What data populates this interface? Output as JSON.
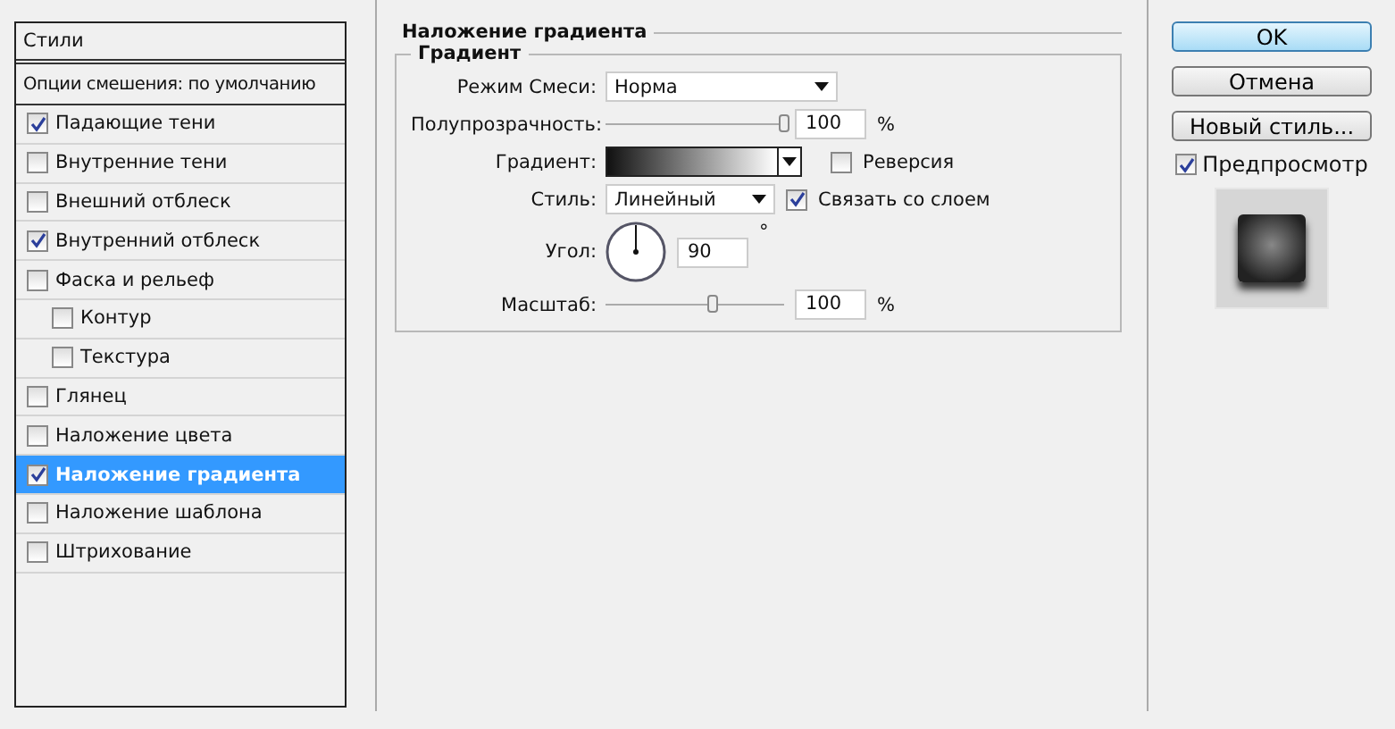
{
  "styles_panel": {
    "items": [
      {
        "kind": "header",
        "label": "Стили",
        "selected": false
      },
      {
        "kind": "blending",
        "label": "Опции смешения: по умолчанию",
        "selected": false
      },
      {
        "kind": "effect",
        "label": "Падающие тени",
        "checked": true,
        "selected": false
      },
      {
        "kind": "effect",
        "label": "Внутренние тени",
        "checked": false,
        "selected": false
      },
      {
        "kind": "effect",
        "label": "Внешний отблеск",
        "checked": false,
        "selected": false
      },
      {
        "kind": "effect",
        "label": "Внутренний отблеск",
        "checked": true,
        "selected": false
      },
      {
        "kind": "effect",
        "label": "Фаска и рельеф",
        "checked": false,
        "selected": false,
        "children": [
          {
            "kind": "effect",
            "label": "Контур",
            "checked": false,
            "selected": false
          },
          {
            "kind": "effect",
            "label": "Текстура",
            "checked": false,
            "selected": false
          }
        ]
      },
      {
        "kind": "effect",
        "label": "Глянец",
        "checked": false,
        "selected": false
      },
      {
        "kind": "effect",
        "label": "Наложение цвета",
        "checked": false,
        "selected": false
      },
      {
        "kind": "effect",
        "label": "Наложение градиента",
        "checked": true,
        "selected": true
      },
      {
        "kind": "effect",
        "label": "Наложение шаблона",
        "checked": false,
        "selected": false
      },
      {
        "kind": "effect",
        "label": "Штрихование",
        "checked": false,
        "selected": false
      }
    ]
  },
  "settings": {
    "title": "Наложение градиента",
    "group": "Градиент",
    "blend_mode": {
      "label": "Режим Смеси:",
      "value": "Норма"
    },
    "opacity": {
      "label": "Полупрозрачность:",
      "level": 1.0,
      "value": "100",
      "unit": "%"
    },
    "gradient": {
      "label": "Градиент:"
    },
    "reverse": {
      "label": "Реверсия",
      "checked": false
    },
    "style": {
      "label": "Стиль:",
      "value": "Линейный"
    },
    "align_with_layer": {
      "label": "Связать со слоем",
      "checked": true
    },
    "angle": {
      "label": "Угол:",
      "value": "90",
      "unit": "°"
    },
    "scale": {
      "label": "Масштаб:",
      "level": 0.6,
      "value": "100",
      "unit": "%"
    }
  },
  "buttons": [
    {
      "label": "OK",
      "default": true
    },
    {
      "label": "Отмена",
      "default": false
    },
    {
      "label": "Новый стиль...",
      "default": false
    }
  ],
  "preview": {
    "label": "Предпросмотр",
    "checked": true
  }
}
